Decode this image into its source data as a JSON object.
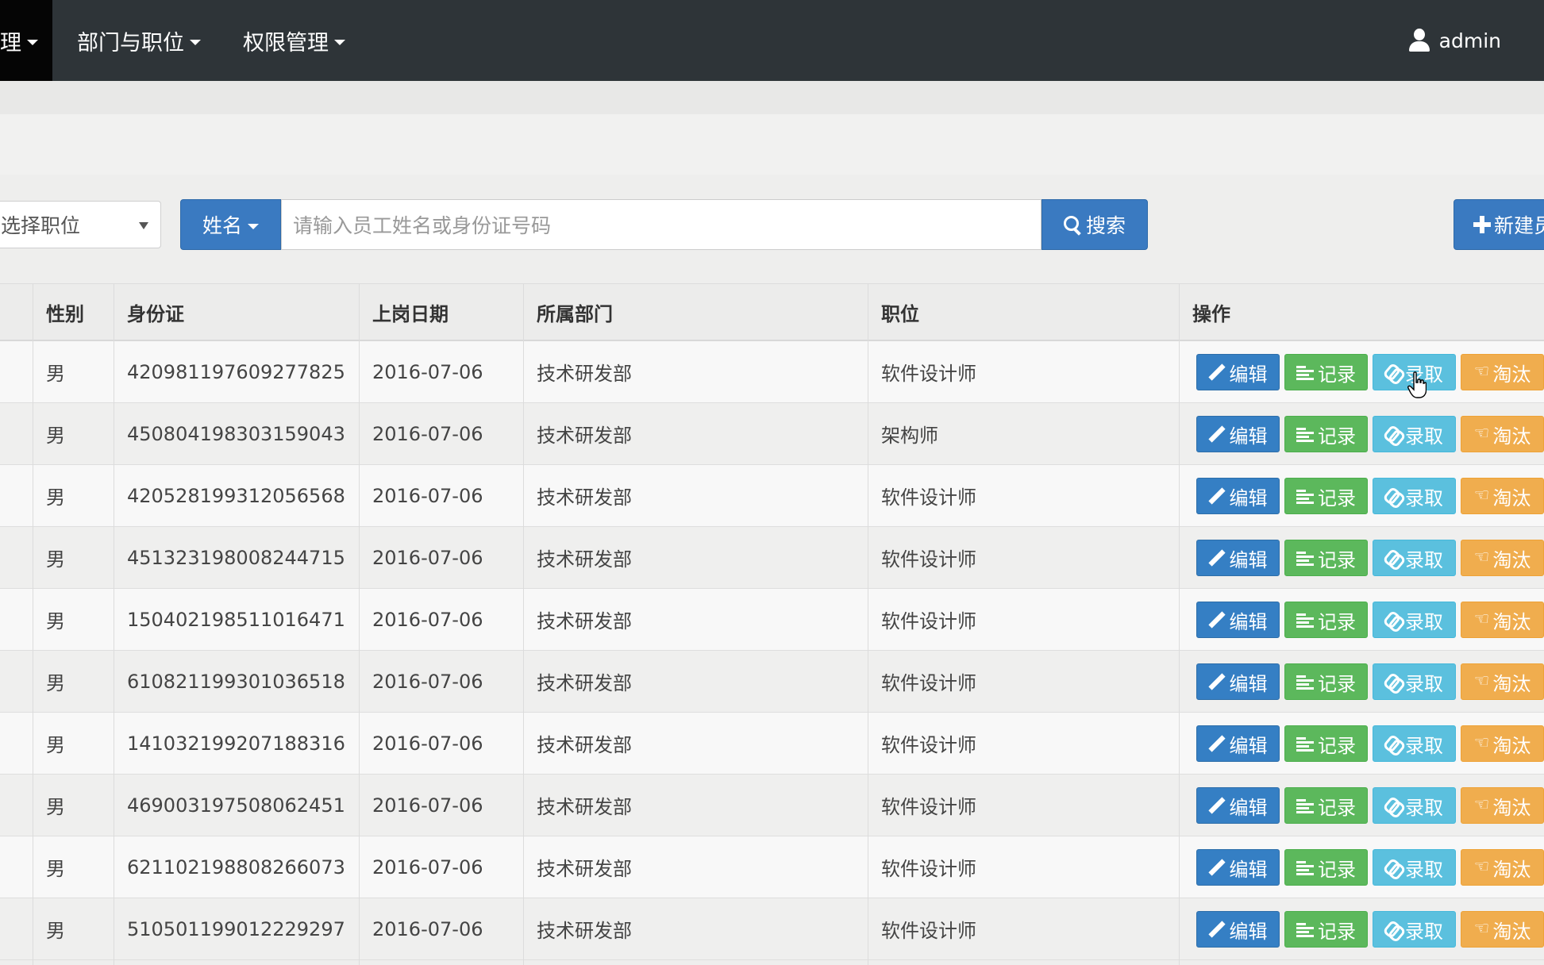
{
  "navbar": {
    "active_label": "理",
    "menus": [
      {
        "label": "部门与职位"
      },
      {
        "label": "权限管理"
      }
    ],
    "user": "admin"
  },
  "filter": {
    "position_select": "选择职位",
    "field_select": "姓名",
    "search_placeholder": "请输入员工姓名或身份证号码",
    "search_button": "搜索",
    "new_button": "新建员"
  },
  "table": {
    "headers": [
      "性别",
      "身份证",
      "上岗日期",
      "所属部门",
      "职位",
      "操作"
    ],
    "actions": {
      "edit": "编辑",
      "record": "记录",
      "hire": "录取",
      "eliminate": "淘汰"
    },
    "rows": [
      {
        "gender": "男",
        "id": "420981197609277825",
        "date": "2016-07-06",
        "dept": "技术研发部",
        "position": "软件设计师"
      },
      {
        "gender": "男",
        "id": "450804198303159043",
        "date": "2016-07-06",
        "dept": "技术研发部",
        "position": "架构师"
      },
      {
        "gender": "男",
        "id": "420528199312056568",
        "date": "2016-07-06",
        "dept": "技术研发部",
        "position": "软件设计师"
      },
      {
        "gender": "男",
        "id": "451323198008244715",
        "date": "2016-07-06",
        "dept": "技术研发部",
        "position": "软件设计师"
      },
      {
        "gender": "男",
        "id": "150402198511016471",
        "date": "2016-07-06",
        "dept": "技术研发部",
        "position": "软件设计师"
      },
      {
        "gender": "男",
        "id": "610821199301036518",
        "date": "2016-07-06",
        "dept": "技术研发部",
        "position": "软件设计师"
      },
      {
        "gender": "男",
        "id": "141032199207188316",
        "date": "2016-07-06",
        "dept": "技术研发部",
        "position": "软件设计师"
      },
      {
        "gender": "男",
        "id": "469003197508062451",
        "date": "2016-07-06",
        "dept": "技术研发部",
        "position": "软件设计师"
      },
      {
        "gender": "男",
        "id": "621102198808266073",
        "date": "2016-07-06",
        "dept": "技术研发部",
        "position": "软件设计师"
      },
      {
        "gender": "男",
        "id": "510501199012229297",
        "date": "2016-07-06",
        "dept": "技术研发部",
        "position": "软件设计师"
      }
    ]
  }
}
